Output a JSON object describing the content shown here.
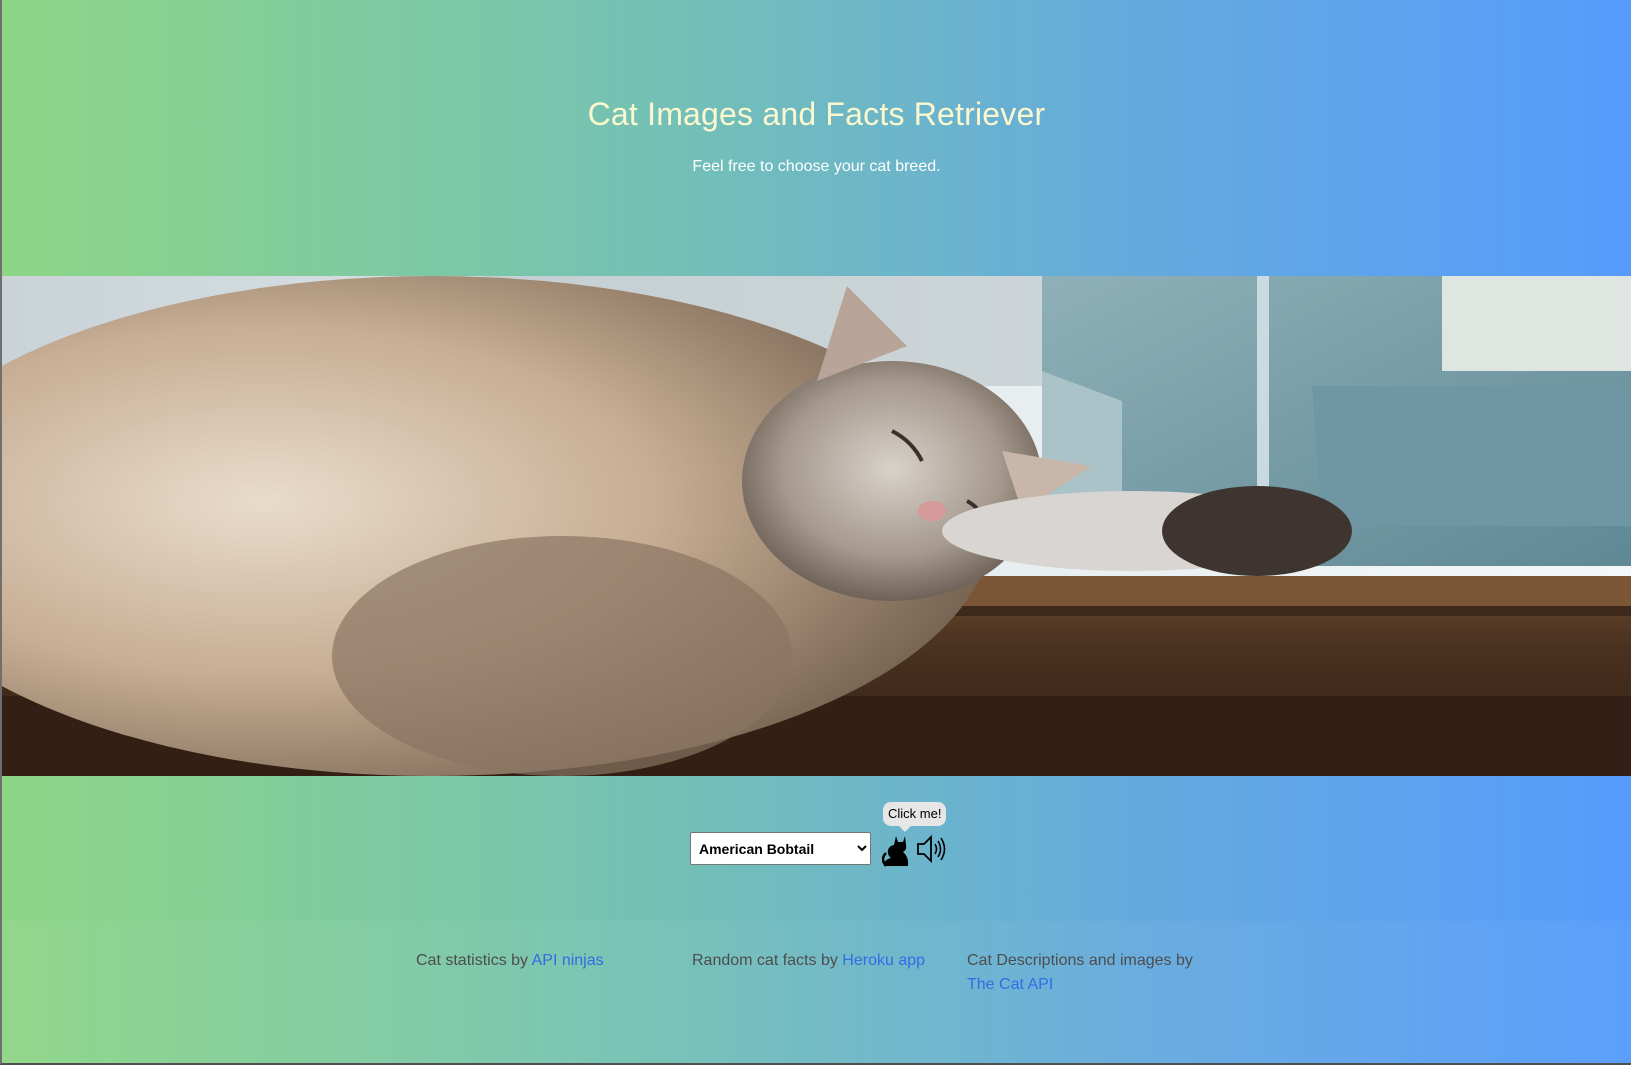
{
  "header": {
    "title": "Cat Images and Facts Retriever",
    "subtitle": "Feel free to choose your cat breed."
  },
  "hero": {
    "alt": "Sleeping cat on a windowsill"
  },
  "controls": {
    "selected_breed": "American Bobtail",
    "tooltip": "Click me!",
    "cat_icon": "cat-silhouette-icon",
    "speaker_icon": "speaker-icon"
  },
  "footer": {
    "credits": [
      {
        "prefix": "Cat statistics by ",
        "link_text": "API ninjas"
      },
      {
        "prefix": "Random cat facts by ",
        "link_text": "Heroku app"
      },
      {
        "prefix": "Cat Descriptions and images by ",
        "link_text": "The Cat API"
      }
    ],
    "link_color": "#2f6ee6"
  },
  "colors": {
    "gradient_start": "#8ed686",
    "gradient_end": "#559cfd",
    "title": "#fbf7cf"
  }
}
